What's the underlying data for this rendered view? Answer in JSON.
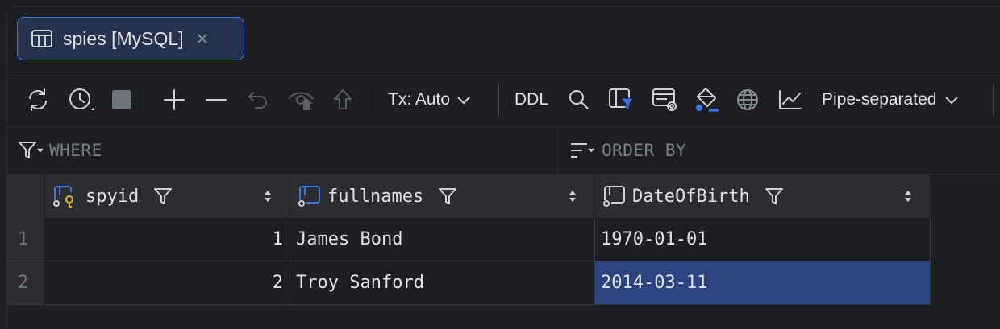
{
  "tab": {
    "title": "spies [MySQL]",
    "close": "×"
  },
  "toolbar": {
    "tx_label": "Tx: Auto",
    "ddl_label": "DDL",
    "format_label": "Pipe-separated"
  },
  "filters": {
    "where_label": "WHERE",
    "order_label": "ORDER BY"
  },
  "table": {
    "columns": [
      {
        "name": "spyid",
        "icon": "primary-key-column-icon"
      },
      {
        "name": "fullnames",
        "icon": "column-icon"
      },
      {
        "name": "DateOfBirth",
        "icon": "column-icon"
      }
    ],
    "rows": [
      {
        "num": "1",
        "spyid": "1",
        "fullnames": "James Bond",
        "dob": "1970-01-01"
      },
      {
        "num": "2",
        "spyid": "2",
        "fullnames": "Troy Sanford",
        "dob": "2014-03-11"
      }
    ]
  },
  "colors": {
    "accent": "#3574f0",
    "selection": "#2e4482",
    "background": "#1e1f22",
    "header": "#2b2d30"
  }
}
